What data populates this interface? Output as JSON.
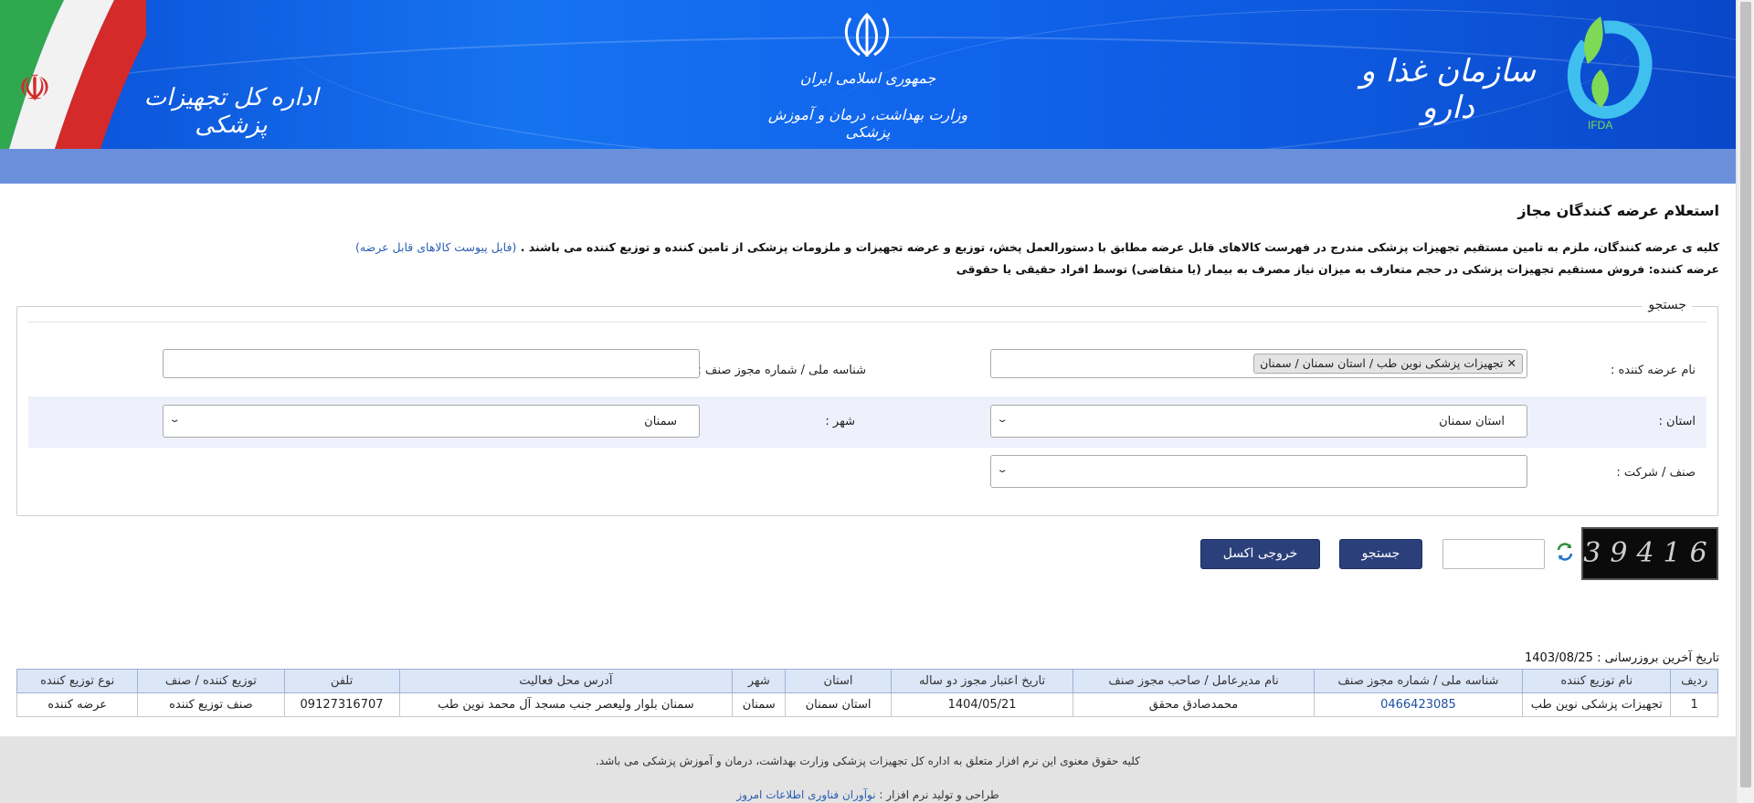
{
  "header": {
    "department_title": "اداره کل تجهیزات پزشکی",
    "gov_line1": "جمهوری اسلامی ایران",
    "gov_line2": "وزارت بهداشت، درمان و آموزش پزشکی",
    "org_title": "سازمان غذا و دارو",
    "logo_text": "IFDA"
  },
  "page": {
    "title": "استعلام عرضه کنندگان مجاز",
    "description1": "کلیه ی عرضه کنندگان، ملزم به تامین مستقیم تجهیزات پزشکی مندرج در فهرست کالاهای قابل عرضه مطابق با دستورالعمل پخش، توزیع و عرضه تجهیزات و ملزومات پزشکی از تامین کننده و توزیع کننده می باشند .",
    "description1_link": "(فایل پیوست کالاهای قابل عرضه)",
    "description2": "عرضه کننده: فروش مستقیم تجهیزات پزشکی در حجم متعارف به میزان نیاز مصرف به بیمار (یا متقاضی) توسط افراد حقیقی یا حقوقی"
  },
  "search": {
    "legend": "جستجو",
    "supplier_name_label": "نام عرضه کننده :",
    "supplier_name_tag": "تجهیزات پزشکی نوین طب / استان سمنان / سمنان",
    "national_id_label": "شناسه ملی / شماره مجوز صنف :",
    "national_id_value": "",
    "province_label": "استان :",
    "province_value": "استان سمنان",
    "city_label": "شهر :",
    "city_value": "سمنان",
    "guild_label": "صنف / شرکت :",
    "guild_value": "",
    "captcha_text": "39416",
    "captcha_input": "",
    "search_button": "جستجو",
    "excel_button": "خروجی اکسل"
  },
  "results": {
    "update_date": "تاریخ آخرین بروزرسانی : 1403/08/25",
    "columns": [
      "ردیف",
      "نام توزیع کننده",
      "شناسه ملی / شماره مجوز صنف",
      "نام مدیرعامل / صاحب مجوز صنف",
      "تاریخ اعتبار مجوز دو ساله",
      "استان",
      "شهر",
      "آدرس محل فعالیت",
      "تلفن",
      "توزیع کننده / صنف",
      "نوع توزیع کننده"
    ],
    "rows": [
      [
        "1",
        "تجهیزات پزشکی نوین طب",
        "0466423085",
        "محمدصادق محقق",
        "1404/05/21",
        "استان سمنان",
        "سمنان",
        "سمنان بلوار ولیعصر جنب مسجد آل محمد نوین طب",
        "09127316707",
        "صنف توزیع کننده",
        "عرضه کننده"
      ]
    ]
  },
  "footer": {
    "copyright": "کلیه حقوق معنوی این نرم افزار متعلق به اداره کل تجهیزات پزشکی وزارت بهداشت، درمان و آموزش پزشکی می باشد.",
    "credit_prefix": "طراحی و تولید نرم افزار :",
    "credit_link": "نوآوران فناوری اطلاعات امروز"
  },
  "colors": {
    "banner_blue": "#1064ec",
    "subbar": "#6a90dc",
    "button": "#2b3f7a",
    "link": "#2a5db0",
    "table_header": "#dbe6f7",
    "alt_row": "#eef0fb"
  }
}
